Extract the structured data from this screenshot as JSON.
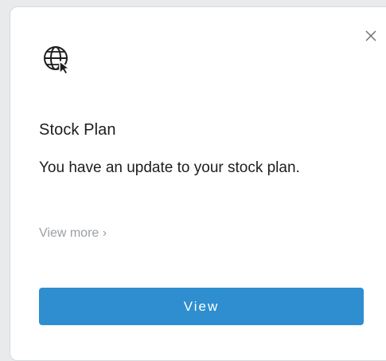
{
  "card": {
    "icon": "globe-cursor-icon",
    "close_icon": "close-icon",
    "title": "Stock Plan",
    "message": "You have an update to your stock plan.",
    "view_more_label": "View more ›",
    "button_label": "View"
  },
  "colors": {
    "button_bg": "#2e8ecf",
    "link_gray": "#9a9ea5",
    "text_dark": "#1d1d1f"
  }
}
